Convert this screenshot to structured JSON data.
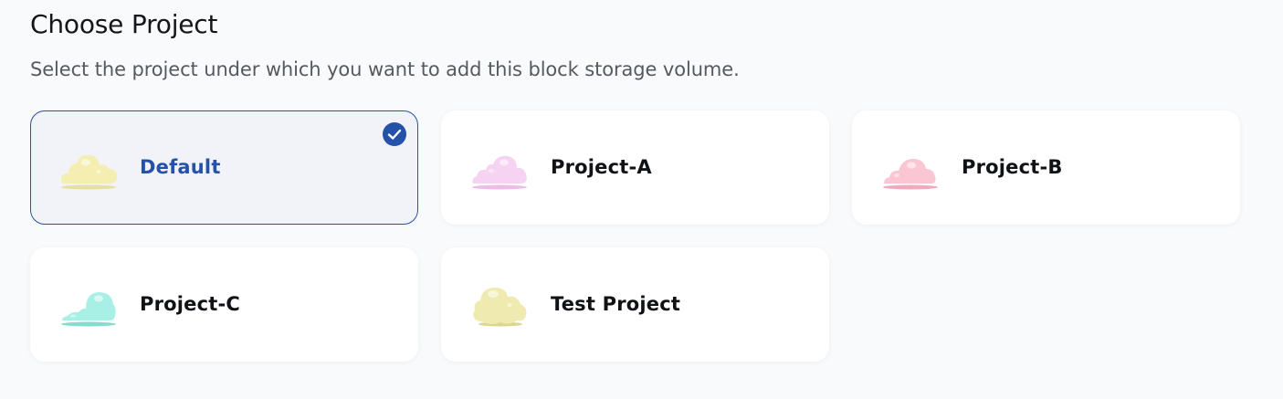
{
  "header": {
    "title": "Choose Project",
    "subtitle": "Select the project under which you want to add this block storage volume."
  },
  "projects": [
    {
      "name": "Default",
      "selected": true,
      "icon": "cloud-icon",
      "color": "#f4efb0"
    },
    {
      "name": "Project-A",
      "selected": false,
      "icon": "cloud-icon",
      "color": "#f7d3f3"
    },
    {
      "name": "Project-B",
      "selected": false,
      "icon": "cloud-icon",
      "color": "#fbc6d4"
    },
    {
      "name": "Project-C",
      "selected": false,
      "icon": "cloud-icon",
      "color": "#a8f0e6"
    },
    {
      "name": "Test Project",
      "selected": false,
      "icon": "cloud-icon",
      "color": "#eeeab0"
    }
  ],
  "colors": {
    "accent": "#2551a8",
    "background": "#f9fafc",
    "card": "#ffffff",
    "selected_card": "#f1f3f8"
  }
}
